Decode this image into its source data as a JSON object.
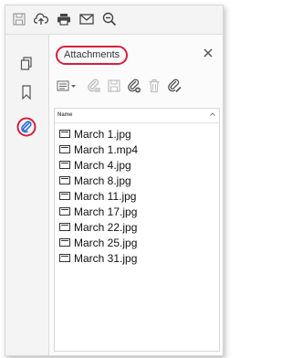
{
  "panel": {
    "title": "Attachments",
    "column_name": "Name"
  },
  "files": [
    "March 1.jpg",
    "March 1.mp4",
    "March 4.jpg",
    "March 8.jpg",
    "March 11.jpg",
    "March 17.jpg",
    "March 22.jpg",
    "March 25.jpg",
    "March 31.jpg"
  ],
  "icons": {
    "toolbar": [
      "save-icon",
      "upload-cloud-icon",
      "print-icon",
      "email-icon",
      "zoom-out-icon"
    ],
    "rail": [
      "page-thumbnails-icon",
      "bookmark-icon",
      "attachment-paperclip-icon"
    ],
    "panel_tools": [
      "options-menu-icon",
      "open-attachment-icon",
      "save-attachment-icon",
      "add-attachment-icon",
      "delete-attachment-icon",
      "edit-description-icon"
    ]
  },
  "colors": {
    "highlight": "#d4213d",
    "attachment_icon": "#2a6fdb"
  }
}
